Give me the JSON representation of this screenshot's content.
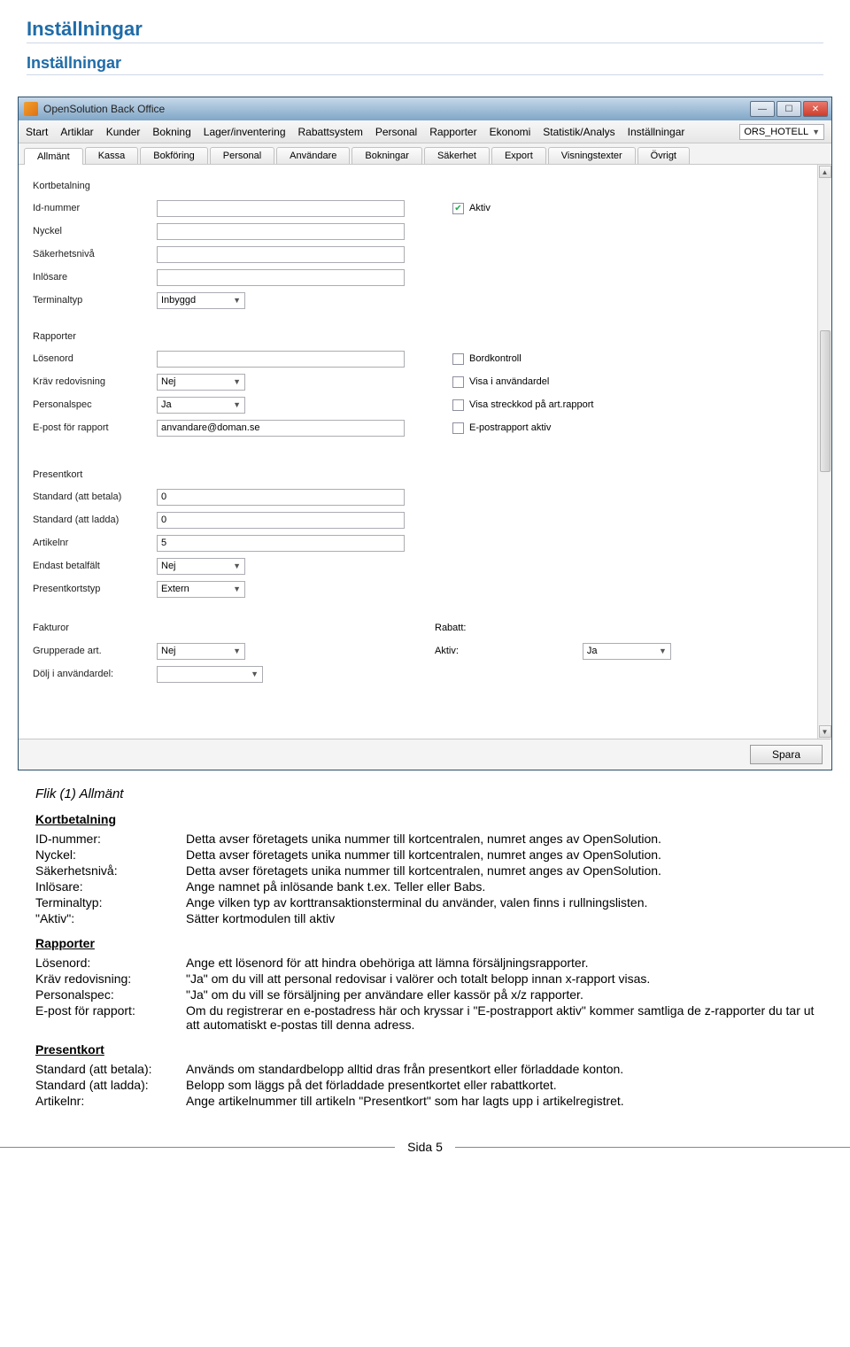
{
  "doc": {
    "title": "Inställningar",
    "subtitle": "Inställningar",
    "flik_line": "Flik (1) Allmänt",
    "footer_page": "Sida 5"
  },
  "window": {
    "title": "OpenSolution Back Office",
    "menu": [
      "Start",
      "Artiklar",
      "Kunder",
      "Bokning",
      "Lager/inventering",
      "Rabattsystem",
      "Personal",
      "Rapporter",
      "Ekonomi",
      "Statistik/Analys",
      "Inställningar"
    ],
    "context_select": "ORS_HOTELL",
    "subtabs": [
      "Allmänt",
      "Kassa",
      "Bokföring",
      "Personal",
      "Användare",
      "Bokningar",
      "Säkerhet",
      "Export",
      "Visningstexter",
      "Övrigt"
    ],
    "active_subtab": 0,
    "save_label": "Spara"
  },
  "form": {
    "kortbetalning": {
      "heading": "Kortbetalning",
      "id_nummer_label": "Id-nummer",
      "id_nummer_value": "",
      "nyckel_label": "Nyckel",
      "nyckel_value": "",
      "sakerhetsniva_label": "Säkerhetsnivå",
      "sakerhetsniva_value": "",
      "inlosare_label": "Inlösare",
      "inlosare_value": "",
      "terminaltyp_label": "Terminaltyp",
      "terminaltyp_value": "Inbyggd",
      "aktiv_label": "Aktiv",
      "aktiv_checked": true
    },
    "rapporter": {
      "heading": "Rapporter",
      "losenord_label": "Lösenord",
      "losenord_value": "",
      "krav_redovisning_label": "Kräv redovisning",
      "krav_redovisning_value": "Nej",
      "personalspec_label": "Personalspec",
      "personalspec_value": "Ja",
      "epost_label": "E-post för rapport",
      "epost_value": "anvandare@doman.se",
      "bordkontroll_label": "Bordkontroll",
      "visa_anvandardel_label": "Visa i användardel",
      "visa_streckkod_label": "Visa streckkod på art.rapport",
      "epostrapport_aktiv_label": "E-postrapport aktiv"
    },
    "presentkort": {
      "heading": "Presentkort",
      "std_betala_label": "Standard (att betala)",
      "std_betala_value": "0",
      "std_ladda_label": "Standard (att ladda)",
      "std_ladda_value": "0",
      "artikelnr_label": "Artikelnr",
      "artikelnr_value": "5",
      "endast_betalfalt_label": "Endast betalfält",
      "endast_betalfalt_value": "Nej",
      "presentkortstyp_label": "Presentkortstyp",
      "presentkortstyp_value": "Extern"
    },
    "fakturor": {
      "heading": "Fakturor",
      "grupperade_label": "Grupperade art.",
      "grupperade_value": "Nej",
      "dolj_label": "Dölj i användardel:",
      "dolj_value": "",
      "rabatt_label": "Rabatt:",
      "aktiv_label": "Aktiv:",
      "aktiv_value": "Ja"
    }
  },
  "explain": {
    "kortbetalning_title": "Kortbetalning",
    "kort_rows": [
      [
        "ID-nummer:",
        "Detta avser företagets unika nummer till kortcentralen, numret anges av OpenSolution."
      ],
      [
        "Nyckel:",
        "Detta avser företagets unika nummer till kortcentralen, numret anges av OpenSolution."
      ],
      [
        "Säkerhetsnivå:",
        "Detta avser företagets unika nummer till kortcentralen, numret anges av OpenSolution."
      ],
      [
        "Inlösare:",
        "Ange namnet på inlösande bank t.ex. Teller eller Babs."
      ],
      [
        "Terminaltyp:",
        "Ange vilken typ av korttransaktionsterminal du använder, valen finns i rullningslisten."
      ],
      [
        "\"Aktiv\":",
        "Sätter kortmodulen till aktiv"
      ]
    ],
    "rapporter_title": "Rapporter",
    "rapp_rows": [
      [
        "Lösenord:",
        "Ange ett lösenord för att hindra obehöriga att lämna försäljningsrapporter."
      ],
      [
        "Kräv redovisning:",
        "\"Ja\" om du vill att personal redovisar i valörer och totalt belopp innan x-rapport visas."
      ],
      [
        "Personalspec:",
        "\"Ja\" om du vill se försäljning per användare eller kassör på x/z rapporter."
      ],
      [
        "E-post för rapport:",
        "Om du registrerar en e-postadress här och kryssar i \"E-postrapport aktiv\" kommer samtliga de z-rapporter du tar ut att automatiskt e-postas till denna adress."
      ]
    ],
    "presentkort_title": "Presentkort",
    "pres_rows": [
      [
        "Standard (att betala):",
        "Används om standardbelopp alltid dras från presentkort eller förladdade konton."
      ],
      [
        "Standard (att ladda):",
        "Belopp som läggs på det förladdade presentkortet eller rabattkortet."
      ],
      [
        "Artikelnr:",
        "Ange artikelnummer till artikeln \"Presentkort\" som har lagts upp i artikelregistret."
      ]
    ]
  }
}
